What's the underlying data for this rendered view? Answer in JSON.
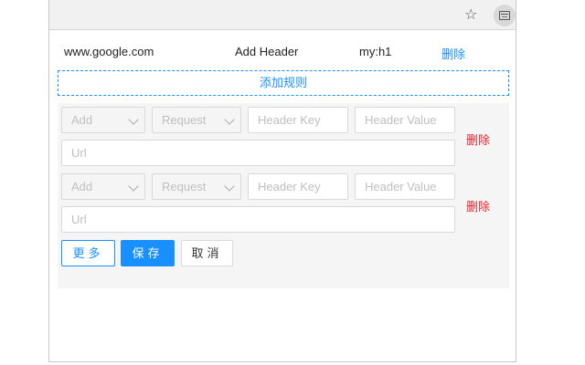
{
  "browser": {
    "star_icon": "star-icon",
    "extension_icon": "header-editor-extension-icon"
  },
  "rule": {
    "url": "www.google.com",
    "action": "Add Header",
    "value": "my:h1",
    "delete_label": "删除"
  },
  "add_rule_label": "添加规则",
  "form": {
    "rows": [
      {
        "action": "Add",
        "type": "Request",
        "key_placeholder": "Header Key",
        "value_placeholder": "Header Value",
        "url_placeholder": "Url",
        "delete_label": "删除"
      },
      {
        "action": "Add",
        "type": "Request",
        "key_placeholder": "Header Key",
        "value_placeholder": "Header Value",
        "url_placeholder": "Url",
        "delete_label": "删除"
      }
    ],
    "more_label": "更多",
    "save_label": "保存",
    "cancel_label": "取消"
  },
  "colors": {
    "primary": "#1890ff",
    "danger": "#f5222d",
    "form_background": "#f5f5f5"
  }
}
